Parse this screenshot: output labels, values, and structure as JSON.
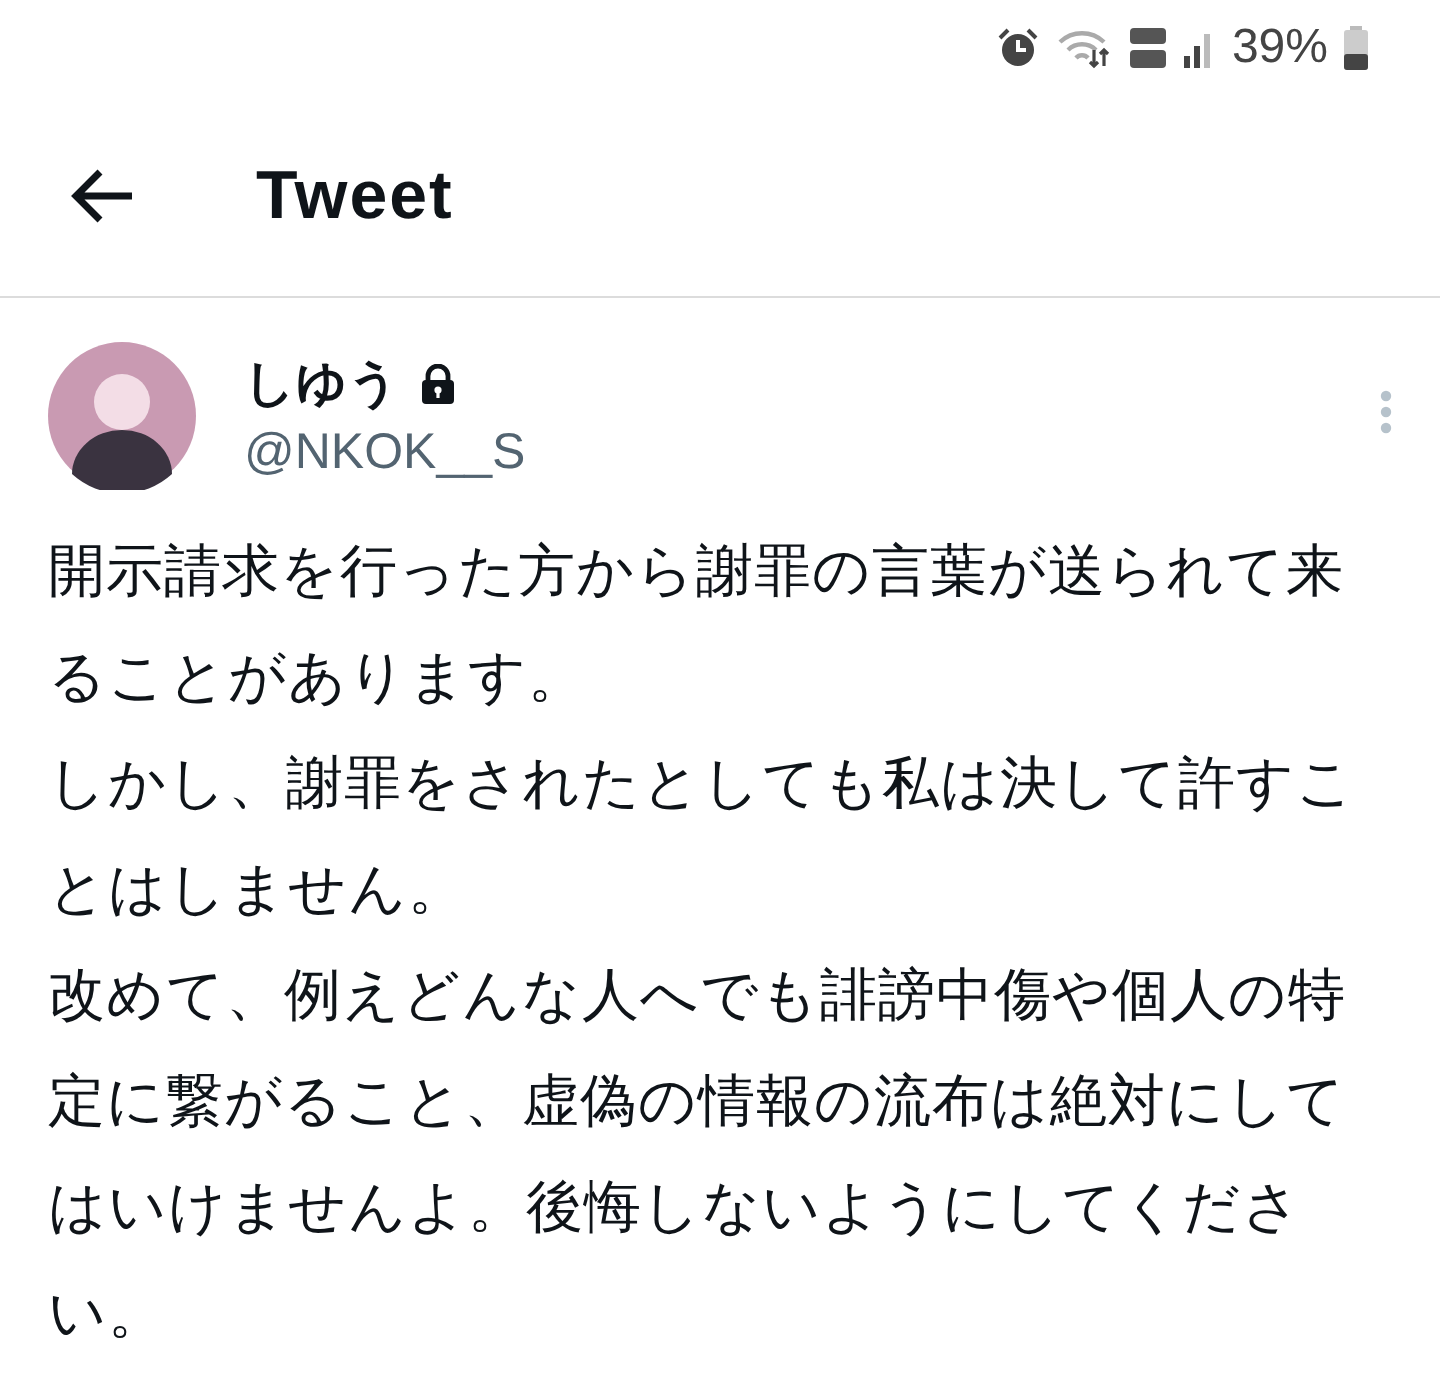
{
  "status_bar": {
    "battery": "39%"
  },
  "header": {
    "title": "Tweet"
  },
  "tweet": {
    "author": {
      "name": "しゆう",
      "protected": true,
      "handle": "@NKOK__S"
    },
    "paragraphs": [
      "開示請求を行った方から謝罪の言葉が送られて来ることがあります。",
      "しかし、謝罪をされたとしても私は決して許すことはしません。",
      "改めて、例えどんな人へでも誹謗中傷や個人の特定に繋がること、虚偽の情報の流布は絶対にしてはいけませんよ。後悔しないようにしてください。"
    ]
  }
}
